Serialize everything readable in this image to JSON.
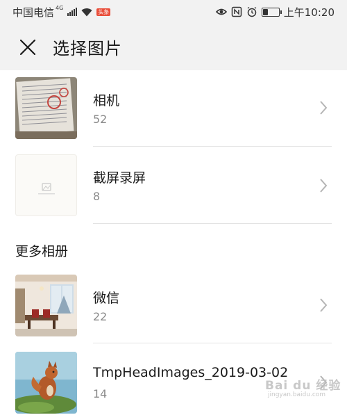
{
  "status_bar": {
    "carrier": "中国电信",
    "network_type": "4G",
    "app_badge": "头条",
    "time": "上午10:20",
    "battery_level": 0.35,
    "icons": [
      "signal-icon",
      "wifi-icon",
      "eye-icon",
      "nfc-icon",
      "alarm-icon",
      "battery-icon"
    ]
  },
  "header": {
    "title": "选择图片",
    "close_icon": "close-icon"
  },
  "albums": [
    {
      "name": "相机",
      "count": "52",
      "thumb": "document-photo"
    },
    {
      "name": "截屏录屏",
      "count": "8",
      "thumb": "image-placeholder"
    }
  ],
  "section": {
    "title": "更多相册"
  },
  "more_albums": [
    {
      "name": "微信",
      "count": "22",
      "thumb": "room-photo"
    },
    {
      "name": "TmpHeadImages_2019-03-02",
      "count": "14",
      "thumb": "squirrel-photo"
    }
  ],
  "watermark": {
    "main": "Bai du 经验",
    "sub": "jingyan.baidu.com"
  },
  "colors": {
    "header_bg": "#f2f2f2",
    "divider": "#e3e3e3",
    "secondary_text": "#8a8a8a"
  }
}
